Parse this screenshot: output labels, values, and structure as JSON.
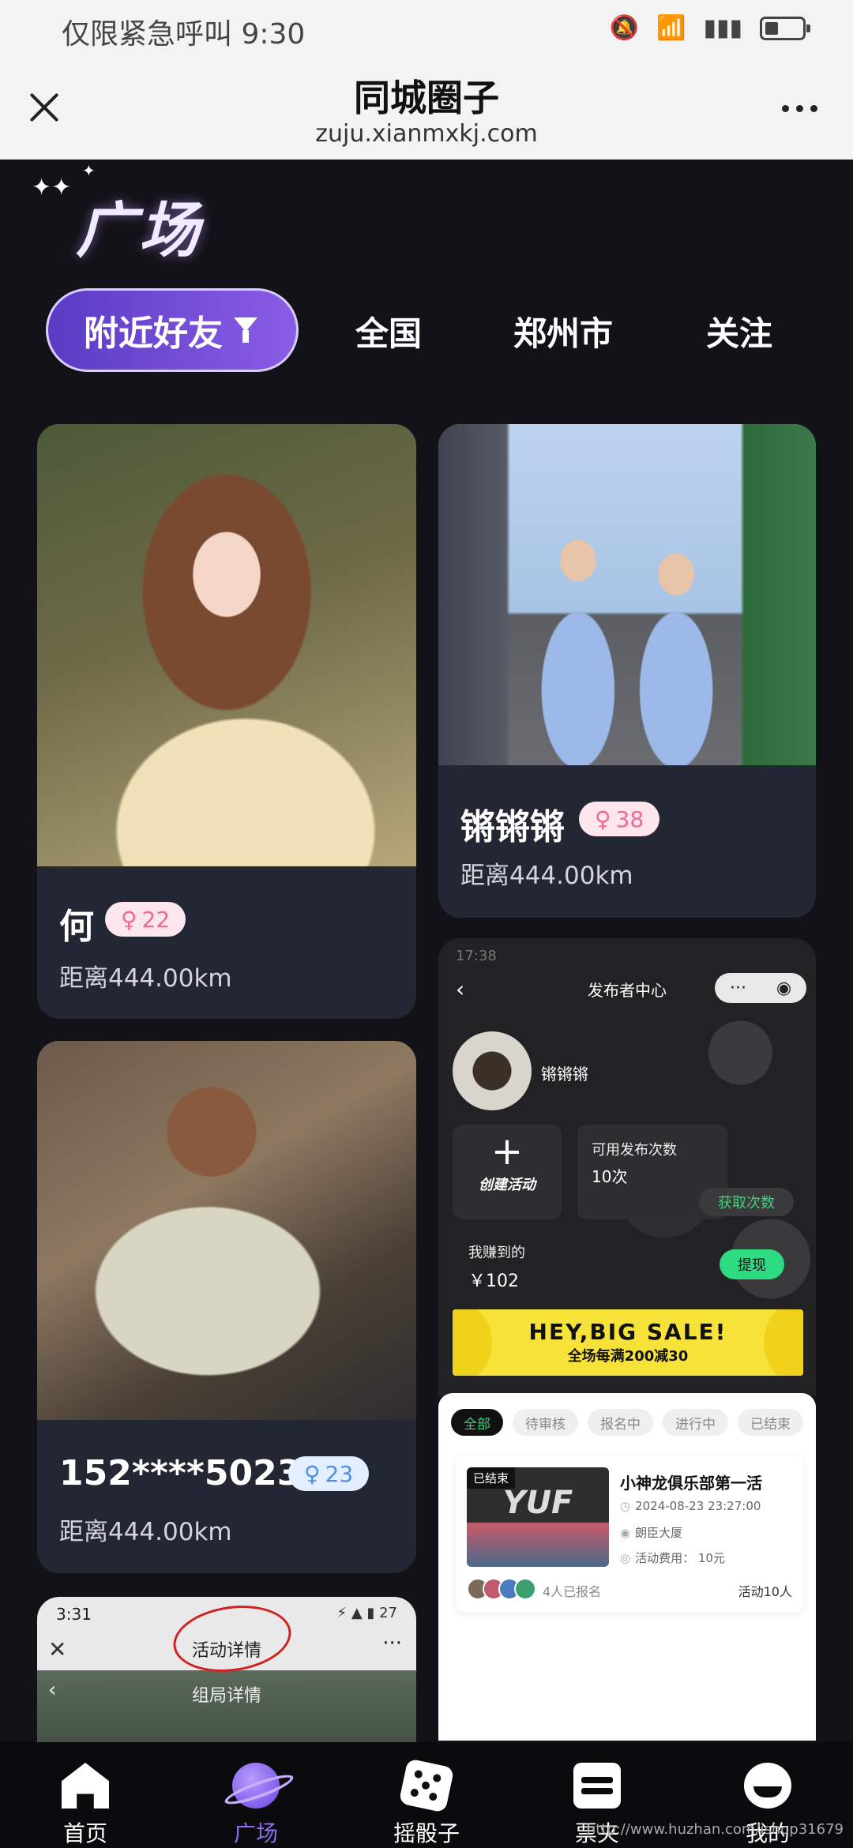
{
  "status_bar": {
    "carrier": "仅限紧急呼叫",
    "time": "9:30",
    "icons": [
      "mute-icon",
      "wifi-icon",
      "signal-icon",
      "battery-icon"
    ]
  },
  "nav": {
    "title": "同城圈子",
    "url": "zuju.xianmxkj.com",
    "close_icon": "close-icon",
    "more_icon": "more-icon"
  },
  "page": {
    "title": "广场"
  },
  "tabs": [
    {
      "label": "附近好友",
      "active": true,
      "icon": "filter-icon"
    },
    {
      "label": "全国",
      "active": false
    },
    {
      "label": "郑州市",
      "active": false
    },
    {
      "label": "关注",
      "active": false
    }
  ],
  "cards": [
    {
      "name": "何",
      "gender": "♀",
      "age": "22",
      "distance": "距离444.00km"
    },
    {
      "name": "锵锵锵",
      "gender": "♀",
      "age": "38",
      "distance": "距离444.00km"
    },
    {
      "name": "152****5023",
      "gender": "♀",
      "age": "23",
      "distance": "距离444.00km"
    }
  ],
  "shot_activity_detail": {
    "time": "3:31",
    "status_icons": "⚡ ▲ ▮ 27",
    "title": "活动详情",
    "subtitle": "组局详情",
    "close": "✕",
    "more": "···",
    "back": "‹"
  },
  "shot_publisher": {
    "time": "17:38",
    "back": "‹",
    "title": "发布者中心",
    "username": "锵锵锵",
    "create_label": "创建活动",
    "count_label": "可用发布次数",
    "count_value": "10次",
    "get_more": "获取次数",
    "earned_label": "我赚到的",
    "earned_value": "￥102",
    "withdraw": "提现",
    "banner_big": "HEY,BIG SALE!",
    "banner_small": "全场每满200减30"
  },
  "shot_activity_list": {
    "filters": [
      "全部",
      "待审核",
      "报名中",
      "进行中",
      "已结束"
    ],
    "activity": {
      "status": "已结束",
      "logo": "YUF",
      "name": "小神龙俱乐部第一活",
      "datetime": "2024-08-23 23:27:00",
      "place": "朗臣大厦",
      "fee": "活动费用：  10元",
      "signed": "4人已报名",
      "capacity": "活动10人"
    }
  },
  "tabbar": [
    {
      "label": "首页",
      "icon": "home-icon",
      "active": false
    },
    {
      "label": "广场",
      "icon": "planet-icon",
      "active": true
    },
    {
      "label": "摇骰子",
      "icon": "dice-icon",
      "active": false
    },
    {
      "label": "票夹",
      "icon": "ticket-icon",
      "active": false
    },
    {
      "label": "我的",
      "icon": "profile-icon",
      "active": false
    }
  ],
  "watermark": "http://www.huzhan.com/ishop31679",
  "colors": {
    "background": "#121218",
    "accent": "#8b6cf0",
    "card": "#232633",
    "female_badge_bg": "#fde6ee",
    "female_badge_fg": "#ef6a92",
    "success_green": "#2ddb83"
  }
}
